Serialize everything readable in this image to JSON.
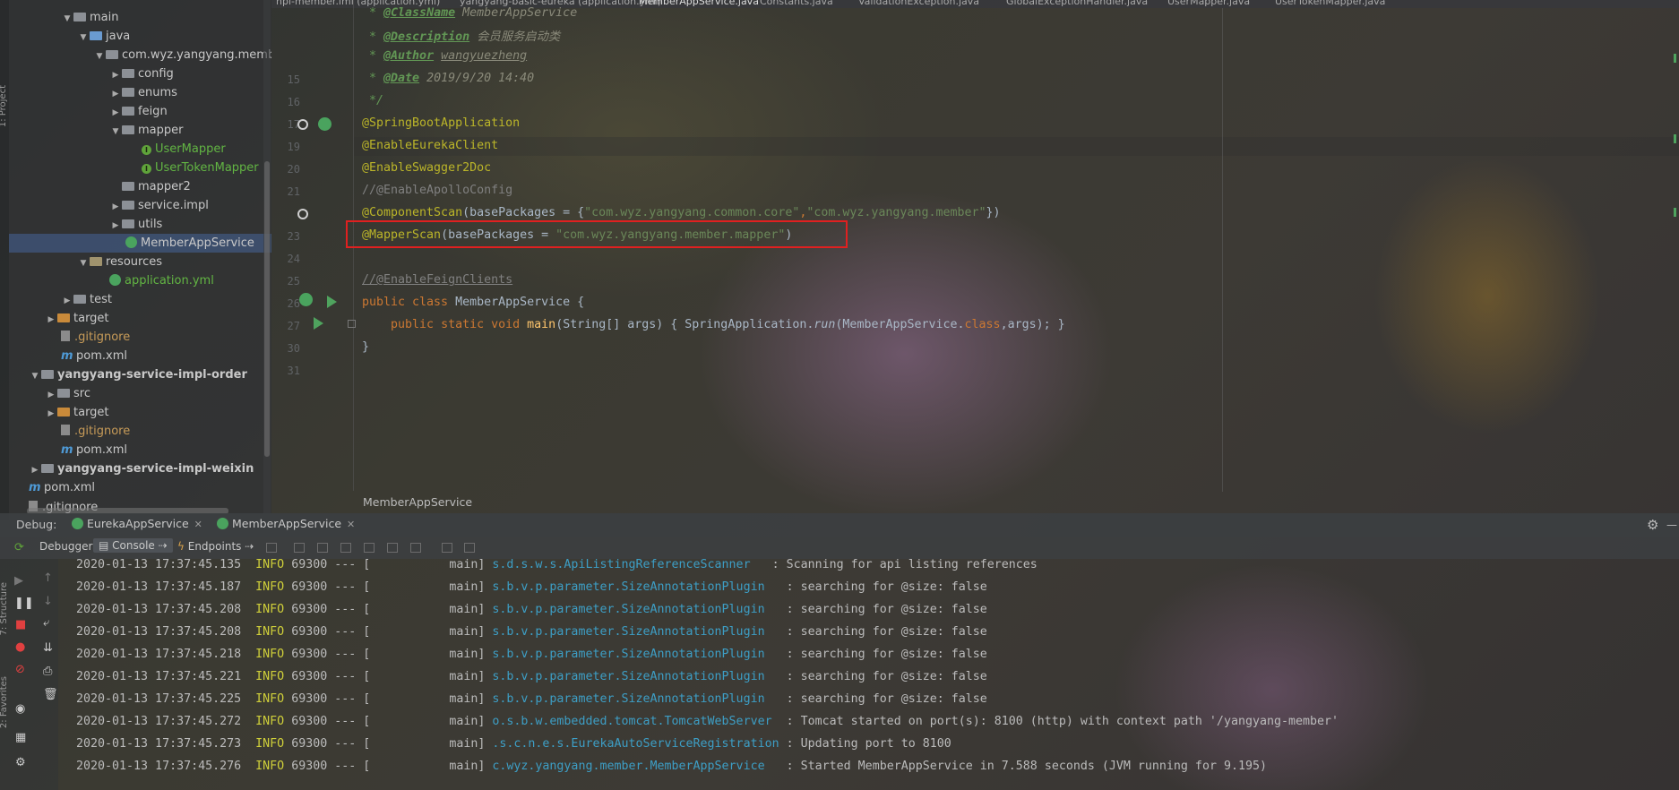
{
  "tree": {
    "items": [
      {
        "label": "main"
      },
      {
        "label": "java"
      },
      {
        "label": "com.wyz.yangyang.member"
      },
      {
        "label": "config"
      },
      {
        "label": "enums"
      },
      {
        "label": "feign"
      },
      {
        "label": "mapper"
      },
      {
        "label": "UserMapper"
      },
      {
        "label": "UserTokenMapper"
      },
      {
        "label": "mapper2"
      },
      {
        "label": "service.impl"
      },
      {
        "label": "utils"
      },
      {
        "label": "MemberAppService"
      },
      {
        "label": "resources"
      },
      {
        "label": "application.yml"
      },
      {
        "label": "test"
      },
      {
        "label": "target"
      },
      {
        "label": ".gitignore"
      },
      {
        "label": "pom.xml"
      },
      {
        "label": "yangyang-service-impl-order"
      },
      {
        "label": "src"
      },
      {
        "label": "target"
      },
      {
        "label": ".gitignore"
      },
      {
        "label": "pom.xml"
      },
      {
        "label": "yangyang-service-impl-weixin"
      },
      {
        "label": "pom.xml"
      },
      {
        "label": ".gitignore"
      }
    ]
  },
  "edge": {
    "project_label": "1: Project",
    "structure_label": "7: Structure",
    "favorites_label": "2: Favorites"
  },
  "tabs": [
    "hpi-member.iml (application.yml)",
    "yangyang-basic-eureka (application.yml)",
    "MemberAppService.java",
    "Constants.java",
    "ValidationException.java",
    "GlobalExceptionHandler.java",
    "UserMapper.java",
    "UserTokenMapper.java"
  ],
  "editor": {
    "line_numbers": [
      "15",
      "16",
      "17",
      "18",
      "19",
      "20",
      "21",
      "22",
      "23",
      "24",
      "25",
      "26",
      "27",
      "30",
      "31"
    ],
    "doc_classname_tag": "@ClassName",
    "doc_classname_val": "MemberAppService",
    "doc_description_tag": "@Description",
    "doc_description_val": "会员服务启动类",
    "doc_author_tag": "@Author",
    "doc_author_val": "wangyuezheng",
    "doc_date_tag": "@Date",
    "doc_date_val": "2019/9/20 14:40",
    "doc_end": "*/",
    "ann_springboot": "@SpringBootApplication",
    "ann_eureka": "@EnableEurekaClient",
    "ann_swagger": "@EnableSwagger2Doc",
    "comment_apollo": "//@EnableApolloConfig",
    "ann_componentscan": "@ComponentScan",
    "componentscan_args_prefix": "(basePackages = {",
    "componentscan_str1": "\"com.wyz.yangyang.common.core\"",
    "componentscan_sep": ",",
    "componentscan_str2": "\"com.wyz.yangyang.member\"",
    "componentscan_end": "})",
    "ann_mapperscan": "@MapperScan",
    "mapperscan_args_prefix": "(basePackages = ",
    "mapperscan_str": "\"com.wyz.yangyang.member.mapper\"",
    "mapperscan_end": ")",
    "comment_feign": "//@EnableFeignClients",
    "class_kw": "public class",
    "class_name": " MemberAppService {",
    "main_kw": "public static void",
    "main_name": "main",
    "main_args": "(String[] args) { SpringApplication.",
    "main_run": "run",
    "main_call": "(MemberAppService.",
    "main_class_kw": "class",
    "main_tail": ",args); }",
    "close_brace": "}",
    "breadcrumb": "MemberAppService"
  },
  "debug": {
    "label": "Debug:",
    "tabs": [
      "EurekaAppService",
      "MemberAppService"
    ],
    "subtabs": {
      "debugger": "Debugger",
      "console": "Console",
      "endpoints": "Endpoints"
    },
    "console_lines": [
      {
        "ts": "2020-01-13 17:37:45.135",
        "level": "INFO",
        "pid": "69300",
        "sep": "--- [",
        "thread": "main]",
        "logger": "s.d.s.w.s.ApiListingReferenceScanner",
        "msg": ": Scanning for api listing references"
      },
      {
        "ts": "2020-01-13 17:37:45.187",
        "level": "INFO",
        "pid": "69300",
        "sep": "--- [",
        "thread": "main]",
        "logger": "s.b.v.p.parameter.SizeAnnotationPlugin",
        "msg": ": searching for @size: false"
      },
      {
        "ts": "2020-01-13 17:37:45.208",
        "level": "INFO",
        "pid": "69300",
        "sep": "--- [",
        "thread": "main]",
        "logger": "s.b.v.p.parameter.SizeAnnotationPlugin",
        "msg": ": searching for @size: false"
      },
      {
        "ts": "2020-01-13 17:37:45.208",
        "level": "INFO",
        "pid": "69300",
        "sep": "--- [",
        "thread": "main]",
        "logger": "s.b.v.p.parameter.SizeAnnotationPlugin",
        "msg": ": searching for @size: false"
      },
      {
        "ts": "2020-01-13 17:37:45.218",
        "level": "INFO",
        "pid": "69300",
        "sep": "--- [",
        "thread": "main]",
        "logger": "s.b.v.p.parameter.SizeAnnotationPlugin",
        "msg": ": searching for @size: false"
      },
      {
        "ts": "2020-01-13 17:37:45.221",
        "level": "INFO",
        "pid": "69300",
        "sep": "--- [",
        "thread": "main]",
        "logger": "s.b.v.p.parameter.SizeAnnotationPlugin",
        "msg": ": searching for @size: false"
      },
      {
        "ts": "2020-01-13 17:37:45.225",
        "level": "INFO",
        "pid": "69300",
        "sep": "--- [",
        "thread": "main]",
        "logger": "s.b.v.p.parameter.SizeAnnotationPlugin",
        "msg": ": searching for @size: false"
      },
      {
        "ts": "2020-01-13 17:37:45.272",
        "level": "INFO",
        "pid": "69300",
        "sep": "--- [",
        "thread": "main]",
        "logger": "o.s.b.w.embedded.tomcat.TomcatWebServer",
        "msg": ": Tomcat started on port(s): 8100 (http) with context path '/yangyang-member'"
      },
      {
        "ts": "2020-01-13 17:37:45.273",
        "level": "INFO",
        "pid": "69300",
        "sep": "--- [",
        "thread": "main]",
        "logger": ".s.c.n.e.s.EurekaAutoServiceRegistration",
        "msg": ": Updating port to 8100"
      },
      {
        "ts": "2020-01-13 17:37:45.276",
        "level": "INFO",
        "pid": "69300",
        "sep": "--- [",
        "thread": "main]",
        "logger": "c.wyz.yangyang.member.MemberAppService",
        "msg": ": Started MemberAppService in 7.588 seconds (JVM running for 9.195)"
      }
    ]
  },
  "icons": {
    "gear": "gear-icon",
    "close": "close-icon",
    "expand": "triangle-right",
    "collapse": "triangle-down"
  },
  "colors": {
    "selection": "#4b6eaf",
    "red_box": "#e02020",
    "annotation": "#bbb529",
    "keyword": "#cc7832",
    "string": "#6a8759",
    "info": "#cfcf3a",
    "logger": "#3d9ec5"
  }
}
